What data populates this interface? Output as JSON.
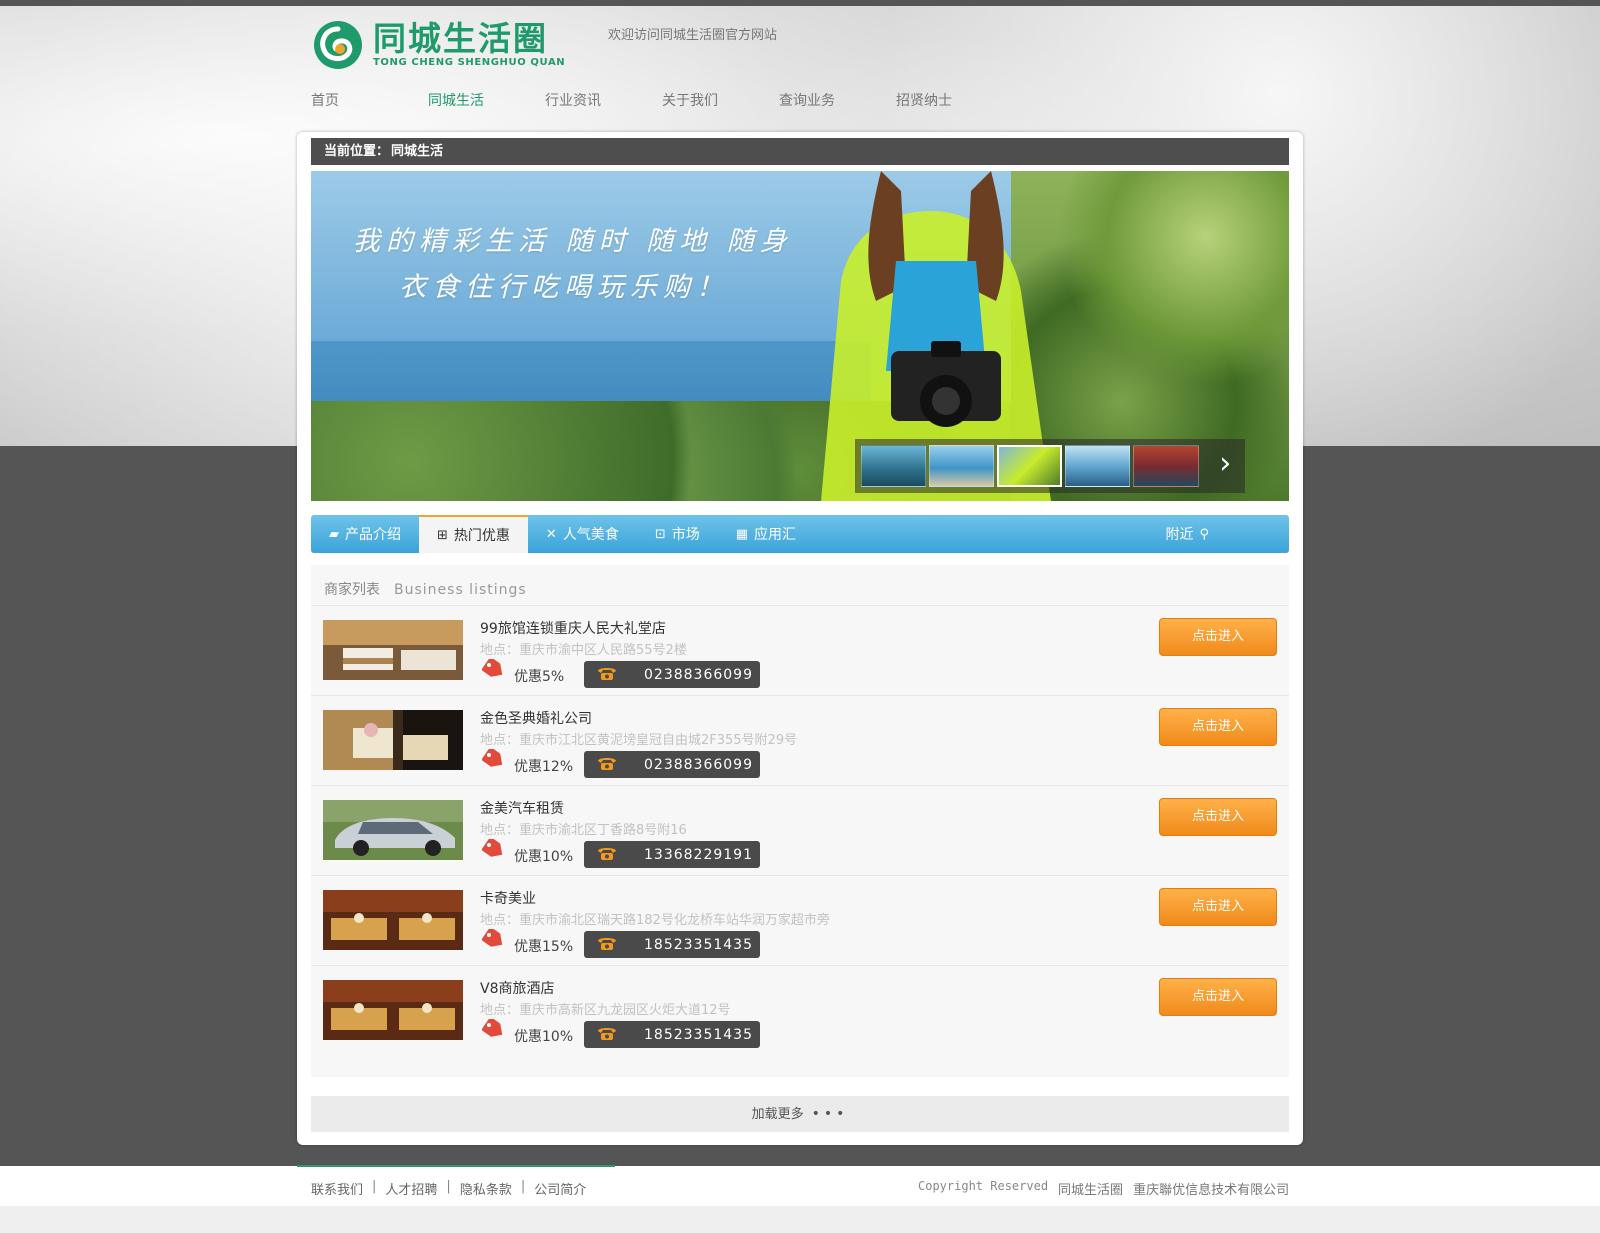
{
  "site": {
    "logo_cn": "同城生活圈",
    "logo_en": "TONG CHENG SHENGHUO QUAN",
    "welcome": "欢迎访问同城生活圈官方网站"
  },
  "nav": {
    "items": [
      "首页",
      "同城生活",
      "行业资讯",
      "关于我们",
      "查询业务",
      "招贤纳士"
    ],
    "active": "同城生活"
  },
  "breadcrumb": {
    "prefix": "当前位置：",
    "current": "同城生活"
  },
  "banner": {
    "line1": "我的精彩生活 随时 随地 随身",
    "line2": "衣食住行吃喝玩乐购！",
    "thumb_count": 5,
    "selected_thumb": 3
  },
  "tabs": {
    "items": [
      {
        "label": "产品介绍",
        "icon": "book-icon"
      },
      {
        "label": "热门优惠",
        "icon": "basket-icon"
      },
      {
        "label": "人气美食",
        "icon": "utensils-icon"
      },
      {
        "label": "市场",
        "icon": "cart-icon"
      },
      {
        "label": "应用汇",
        "icon": "calendar-icon"
      }
    ],
    "nearby": "附近",
    "active": "热门优惠"
  },
  "listings": {
    "title_cn": "商家列表",
    "title_en": "Business listings",
    "enter_label": "点击进入",
    "discount_prefix": "优惠",
    "items": [
      {
        "name": "99旅馆连锁重庆人民大礼堂店",
        "address": "地点：重庆市渝中区人民路55号2楼",
        "discount": "5%",
        "phone": "02388366099"
      },
      {
        "name": "金色圣典婚礼公司",
        "address": "地点：重庆市江北区黄泥塝皇冠自由城2F355号附29号",
        "discount": "12%",
        "phone": "02388366099"
      },
      {
        "name": "金美汽车租赁",
        "address": "地点：重庆市渝北区丁香路8号附16",
        "discount": "10%",
        "phone": "13368229191"
      },
      {
        "name": "卡奇美业",
        "address": "地点：重庆市渝北区瑞天路182号化龙桥车站华润万家超市旁",
        "discount": "15%",
        "phone": "18523351435"
      },
      {
        "name": "V8商旅酒店",
        "address": "地点：重庆市高新区九龙园区火炬大道12号",
        "discount": "10%",
        "phone": "18523351435"
      }
    ]
  },
  "load_more": {
    "label": "加载更多",
    "dots": "•••"
  },
  "footer": {
    "links": [
      "联系我们",
      "人才招聘",
      "隐私条款",
      "公司简介"
    ],
    "copyright": "Copyright Reserved",
    "brand": "同城生活圈",
    "company": "重庆聯优信息技术有限公司"
  },
  "colors": {
    "brand_green": "#1f9a6b",
    "tab_blue": "#3aa3d9",
    "button_orange": "#f08a1a",
    "dark_gray": "#4e4e4e"
  }
}
